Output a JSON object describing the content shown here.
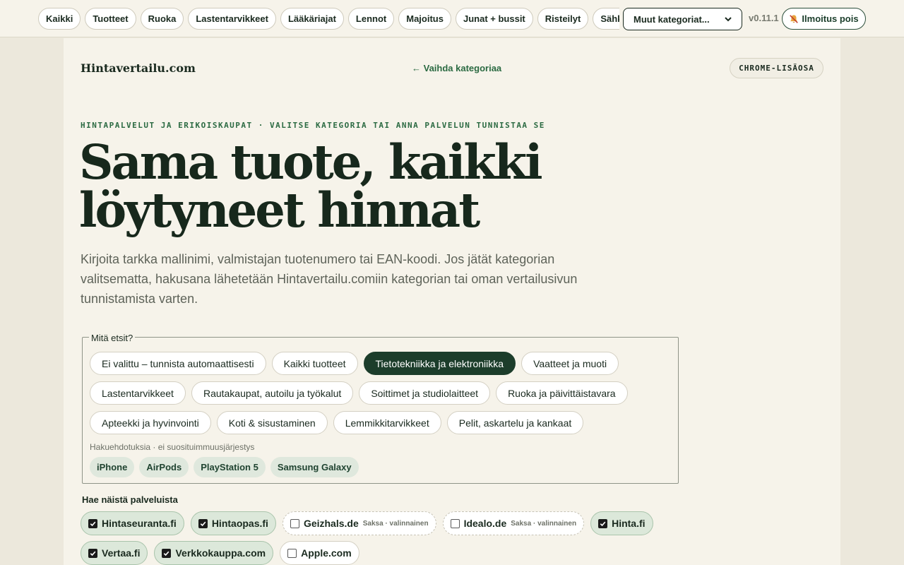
{
  "topbar": {
    "nav": [
      "Kaikki",
      "Tuotteet",
      "Ruoka",
      "Lastentarvikkeet",
      "Lääkäriajat",
      "Lennot",
      "Majoitus",
      "Junat + bussit",
      "Risteilyt",
      "Sähk"
    ],
    "more_categories": "Muut kategoriat...",
    "version": "v0.11.1",
    "notifications_button": "Ilmoitus pois"
  },
  "header": {
    "brand": "Hintavertailu.com",
    "switch_category": "← Vaihda kategoriaa",
    "chrome_badge": "CHROME-LISÄOSA"
  },
  "hero": {
    "eyebrow": "HINTAPALVELUT JA ERIKOISKAUPAT · VALITSE KATEGORIA TAI ANNA PALVELUN TUNNISTAA SE",
    "title": "Sama tuote, kaikki löytyneet hinnat",
    "lede": "Kirjoita tarkka mallinimi, valmistajan tuotenumero tai EAN-koodi. Jos jätät kategorian valitsematta, hakusana lähetetään Hintavertailu.comiin kategorian tai oman vertailusivun tunnistamista varten."
  },
  "search": {
    "legend": "Mitä etsit?",
    "categories": [
      {
        "label": "Ei valittu – tunnista automaattisesti",
        "active": false
      },
      {
        "label": "Kaikki tuotteet",
        "active": false
      },
      {
        "label": "Tietotekniikka ja elektroniikka",
        "active": true
      },
      {
        "label": "Vaatteet ja muoti",
        "active": false
      },
      {
        "label": "Lastentarvikkeet",
        "active": false
      },
      {
        "label": "Rautakaupat, autoilu ja työkalut",
        "active": false
      },
      {
        "label": "Soittimet ja studiolaitteet",
        "active": false
      },
      {
        "label": "Ruoka ja päivittäistavara",
        "active": false
      },
      {
        "label": "Apteekki ja hyvinvointi",
        "active": false
      },
      {
        "label": "Koti & sisustaminen",
        "active": false
      },
      {
        "label": "Lemmikkitarvikkeet",
        "active": false
      },
      {
        "label": "Pelit, askartelu ja kankaat",
        "active": false
      }
    ],
    "suggestions_label": "Hakuehdotuksia · ei suosituimmuusjärjestys",
    "suggestions": [
      "iPhone",
      "AirPods",
      "PlayStation 5",
      "Samsung Galaxy"
    ]
  },
  "services": {
    "label": "Hae näistä palveluista",
    "items": [
      {
        "name": "Hintaseuranta.fi",
        "checked": true,
        "note": ""
      },
      {
        "name": "Hintaopas.fi",
        "checked": true,
        "note": ""
      },
      {
        "name": "Geizhals.de",
        "checked": false,
        "note": "Saksa · valinnainen"
      },
      {
        "name": "Idealo.de",
        "checked": false,
        "note": "Saksa · valinnainen"
      },
      {
        "name": "Hinta.fi",
        "checked": true,
        "note": ""
      },
      {
        "name": "Vertaa.fi",
        "checked": true,
        "note": ""
      },
      {
        "name": "Verkkokauppa.com",
        "checked": true,
        "note": ""
      },
      {
        "name": "Apple.com",
        "checked": false,
        "note": ""
      }
    ]
  }
}
